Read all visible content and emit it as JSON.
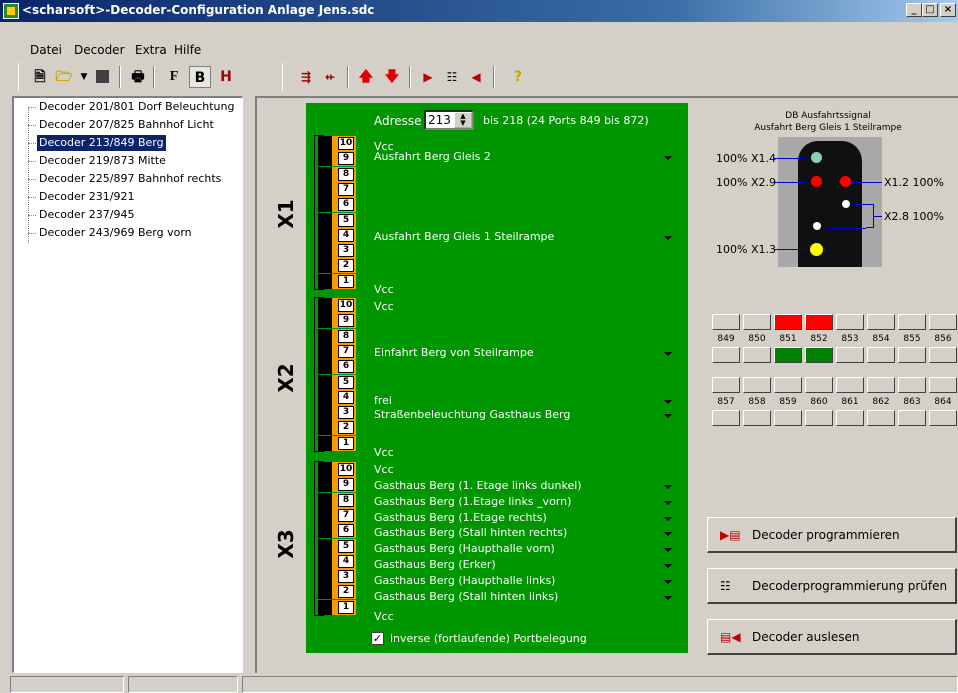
{
  "window": {
    "title": "<scharsoft>-Decoder-Configuration Anlage Jens.sdc",
    "controls": [
      "_",
      "□",
      "×"
    ]
  },
  "menu": [
    "Datei",
    "Decoder",
    "Extra",
    "Hilfe"
  ],
  "toolbar": {
    "format_labels": [
      "F",
      "B",
      "H"
    ],
    "help_label": "?"
  },
  "tree": {
    "items": [
      "Decoder 201/801 Dorf Beleuchtung",
      "Decoder 207/825 Bahnhof Licht",
      "Decoder 213/849 Berg",
      "Decoder 219/873 Mitte",
      "Decoder 225/897 Bahnhof rechts",
      "Decoder 231/921",
      "Decoder 237/945",
      "Decoder 243/969 Berg vorn"
    ],
    "selected_index": 2
  },
  "config": {
    "address_label": "Adresse",
    "address_value": "213",
    "address_range": "bis 218 (24 Ports 849 bis 872)",
    "groups": [
      "X1",
      "X2",
      "X3"
    ],
    "pin_numbers": [
      "10",
      "9",
      "8",
      "7",
      "6",
      "5",
      "4",
      "3",
      "2",
      "1"
    ],
    "x1": {
      "vcc_top": "Vcc",
      "port_a": "Ausfahrt Berg Gleis 2",
      "port_b": "Ausfahrt Berg Gleis 1 Steilrampe",
      "vcc_bottom": "Vcc"
    },
    "x2": {
      "vcc_top": "Vcc",
      "port_a": "Einfahrt Berg von Steilrampe",
      "port_b": "frei",
      "port_c": "Straßenbeleuchtung Gasthaus Berg",
      "vcc_bottom": "Vcc"
    },
    "x3": {
      "vcc_top": "Vcc",
      "ports": [
        "Gasthaus Berg (1. Etage links dunkel)",
        "Gasthaus Berg (1.Etage links _vorn)",
        "Gasthaus Berg (1.Etage rechts)",
        "Gasthaus Berg (Stall hinten rechts)",
        "Gasthaus Berg (Haupthalle vorn)",
        "Gasthaus Berg (Erker)",
        "Gasthaus Berg (Haupthalle links)",
        "Gasthaus Berg (Stall hinten links)"
      ],
      "vcc_bottom": "Vcc"
    },
    "inverse_label": "inverse (fortlaufende) Portbelegung",
    "inverse_checked": true
  },
  "signal": {
    "title_line1": "DB Ausfahrtssignal",
    "title_line2": "Ausfahrt Berg Gleis 1 Steilrampe",
    "labels": {
      "x14": "100% X1.4",
      "x29": "100% X2.9",
      "x12": "X1.2 100%",
      "x28": "X2.8 100%",
      "x13": "100% X1.3"
    },
    "lamp_colors": {
      "green_dim": "#90d0b0",
      "red": "#ff0000",
      "white": "#ffffff",
      "yellow": "#ffff00"
    }
  },
  "ports": {
    "row1_labels": [
      "849",
      "850",
      "851",
      "852",
      "853",
      "854",
      "855",
      "856"
    ],
    "row2_labels": [
      "857",
      "858",
      "859",
      "860",
      "861",
      "862",
      "863",
      "864"
    ],
    "active_color_red": "#ff0000",
    "active_color_green": "#008000"
  },
  "actions": {
    "program": "Decoder programmieren",
    "verify": "Decoderprogrammierung prüfen",
    "read": "Decoder auslesen"
  }
}
